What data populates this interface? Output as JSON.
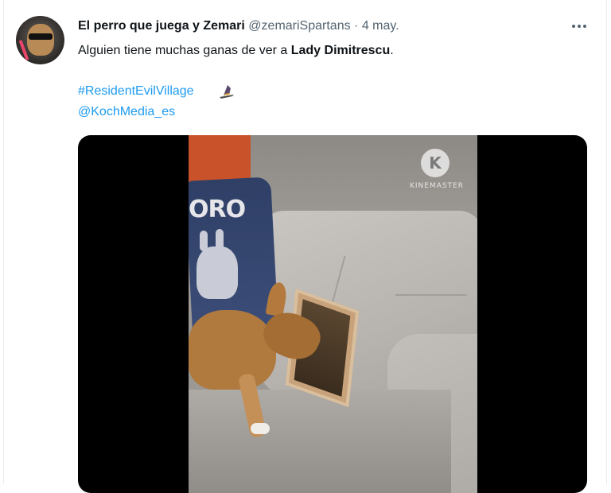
{
  "tweet": {
    "author": {
      "display_name": "El perro que juega y Zemari",
      "handle": "@zemariSpartans",
      "separator": "·",
      "date": "4 may."
    },
    "more_icon": "more-horizontal-icon",
    "text_before": "Alguien tiene muchas ganas de ver a ",
    "text_bold": "Lady Dimitrescu",
    "text_after": ".",
    "hashtag": "#ResidentEvilVillage",
    "hashtag_emoji_icon": "witch-hat-icon",
    "mention": "@KochMedia_es",
    "media": {
      "type": "video",
      "pillow_text": "ORO",
      "watermark_logo_letter": "K",
      "watermark_text": "KINEMASTER"
    }
  },
  "colors": {
    "link": "#1d9bf0",
    "text_primary": "#0f1419",
    "text_secondary": "#536471"
  }
}
